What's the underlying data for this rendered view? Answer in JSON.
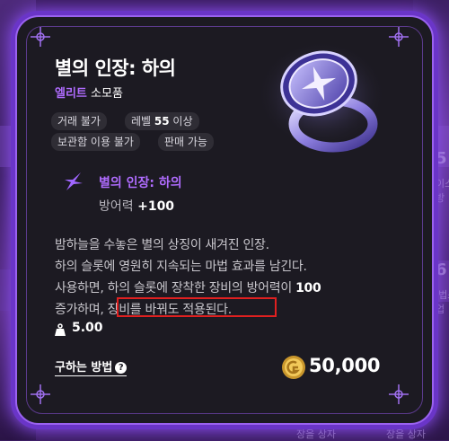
{
  "item": {
    "title": "별의 인장: 하의",
    "grade_label": "엘리트",
    "category": "소모품",
    "tags": [
      {
        "text": "거래 불가"
      },
      {
        "prefix": "레벨 ",
        "bold": "55",
        "suffix": " 이상"
      },
      {
        "text": "보관함 이용 불가"
      },
      {
        "text": "판매 가능"
      }
    ],
    "effect_name": "별의 인장: 하의",
    "stat_label": "방어력",
    "stat_value": "+100",
    "description": [
      "밤하늘을 수놓은 별의 상징이 새겨진 인장.",
      "하의 슬롯에 영원히 지속되는 마법 효과를 남긴다.",
      {
        "before": "사용하면, 하의 슬롯에 장착한 장비의 방어력이 ",
        "bold": "100"
      },
      {
        "before": "증가하며, ",
        "highlight": "장비를 바꿔도 적용된다."
      }
    ],
    "weight": "5.00",
    "how_to_obtain": "구하는 방법",
    "price": "50,000"
  },
  "background": {
    "right_numbers": [
      "5",
      "6"
    ],
    "right_texts": [
      "이스",
      "방",
      "마법소",
      "업"
    ],
    "bottom_texts": [
      "장을 상자",
      "장을 상자"
    ]
  },
  "colors": {
    "accent": "#b06cff",
    "frame": "#9a62f0",
    "highlight_box": "#e02020"
  }
}
